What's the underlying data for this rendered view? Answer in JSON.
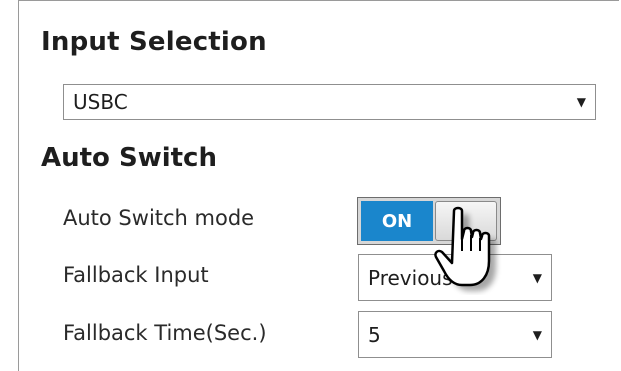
{
  "input_selection": {
    "heading": "Input Selection",
    "selected": "USBC"
  },
  "auto_switch": {
    "heading": "Auto Switch",
    "mode_label": "Auto Switch mode",
    "mode_toggle": "ON",
    "fallback_input_label": "Fallback Input",
    "fallback_input_value": "Previous",
    "fallback_time_label": "Fallback Time(Sec.)",
    "fallback_time_value": "5"
  },
  "icons": {
    "dropdown_arrow": "chevron-down-icon",
    "cursor": "hand-pointer-icon"
  },
  "colors": {
    "toggle_on": "#1a86cc"
  }
}
